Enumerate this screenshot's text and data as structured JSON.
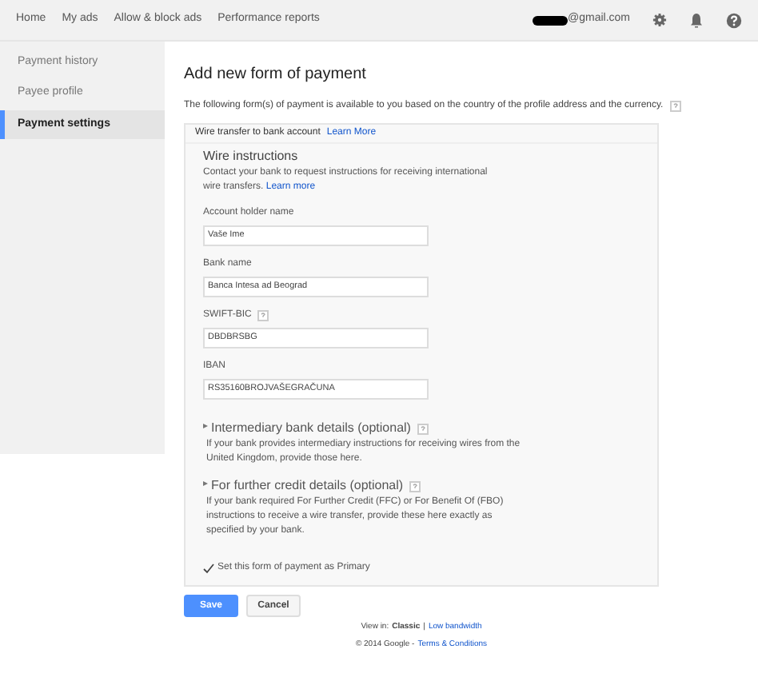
{
  "nav": {
    "items": [
      {
        "label": "Home"
      },
      {
        "label": "My ads"
      },
      {
        "label": "Allow & block ads"
      },
      {
        "label": "Performance reports"
      }
    ],
    "account": "@gmail.com"
  },
  "sidebar": {
    "items": [
      {
        "label": "Payment history",
        "selected": false
      },
      {
        "label": "Payee profile",
        "selected": false
      },
      {
        "label": "Payment settings",
        "selected": true
      }
    ]
  },
  "title": "Add new form of payment",
  "intro": "The following form(s) of payment is available to you based on the country of the profile address and the currency.",
  "card": {
    "method": "Wire transfer to bank account",
    "method_link": "Learn More",
    "section_title": "Wire instructions",
    "section_text": "Contact your bank to request instructions for receiving international wire transfers.",
    "section_link": "Learn more",
    "fields": [
      {
        "label": "Account holder name",
        "value": "Vaše Ime",
        "help": false
      },
      {
        "label": "Bank name",
        "value": "Banca Intesa ad Beograd",
        "help": false
      },
      {
        "label": "SWIFT-BIC",
        "value": "DBDBRSBG",
        "help": true
      },
      {
        "label": "IBAN",
        "value": "RS35160BROJVAŠEGRAČUNA",
        "help": false
      }
    ],
    "optional": [
      {
        "title": "Intermediary bank details (optional)",
        "text": "If your bank provides intermediary instructions for receiving wires from the United Kingdom, provide those here."
      },
      {
        "title": "For further credit details (optional)",
        "text": "If your bank required For Further Credit (FFC) or For Benefit Of (FBO) instructions to receive a wire transfer, provide these here exactly as specified by your bank."
      }
    ],
    "primary": {
      "label": "Set this form of payment as Primary",
      "checked": true
    }
  },
  "buttons": [
    {
      "label": "Save",
      "kind": "primary"
    },
    {
      "label": "Cancel",
      "kind": "secondary"
    }
  ],
  "footer": {
    "view_label": "View in:",
    "view_current": "Classic",
    "view_separator": "|",
    "view_link": "Low bandwidth",
    "copyright": "© 2014 Google -",
    "terms": "Terms & Conditions"
  }
}
